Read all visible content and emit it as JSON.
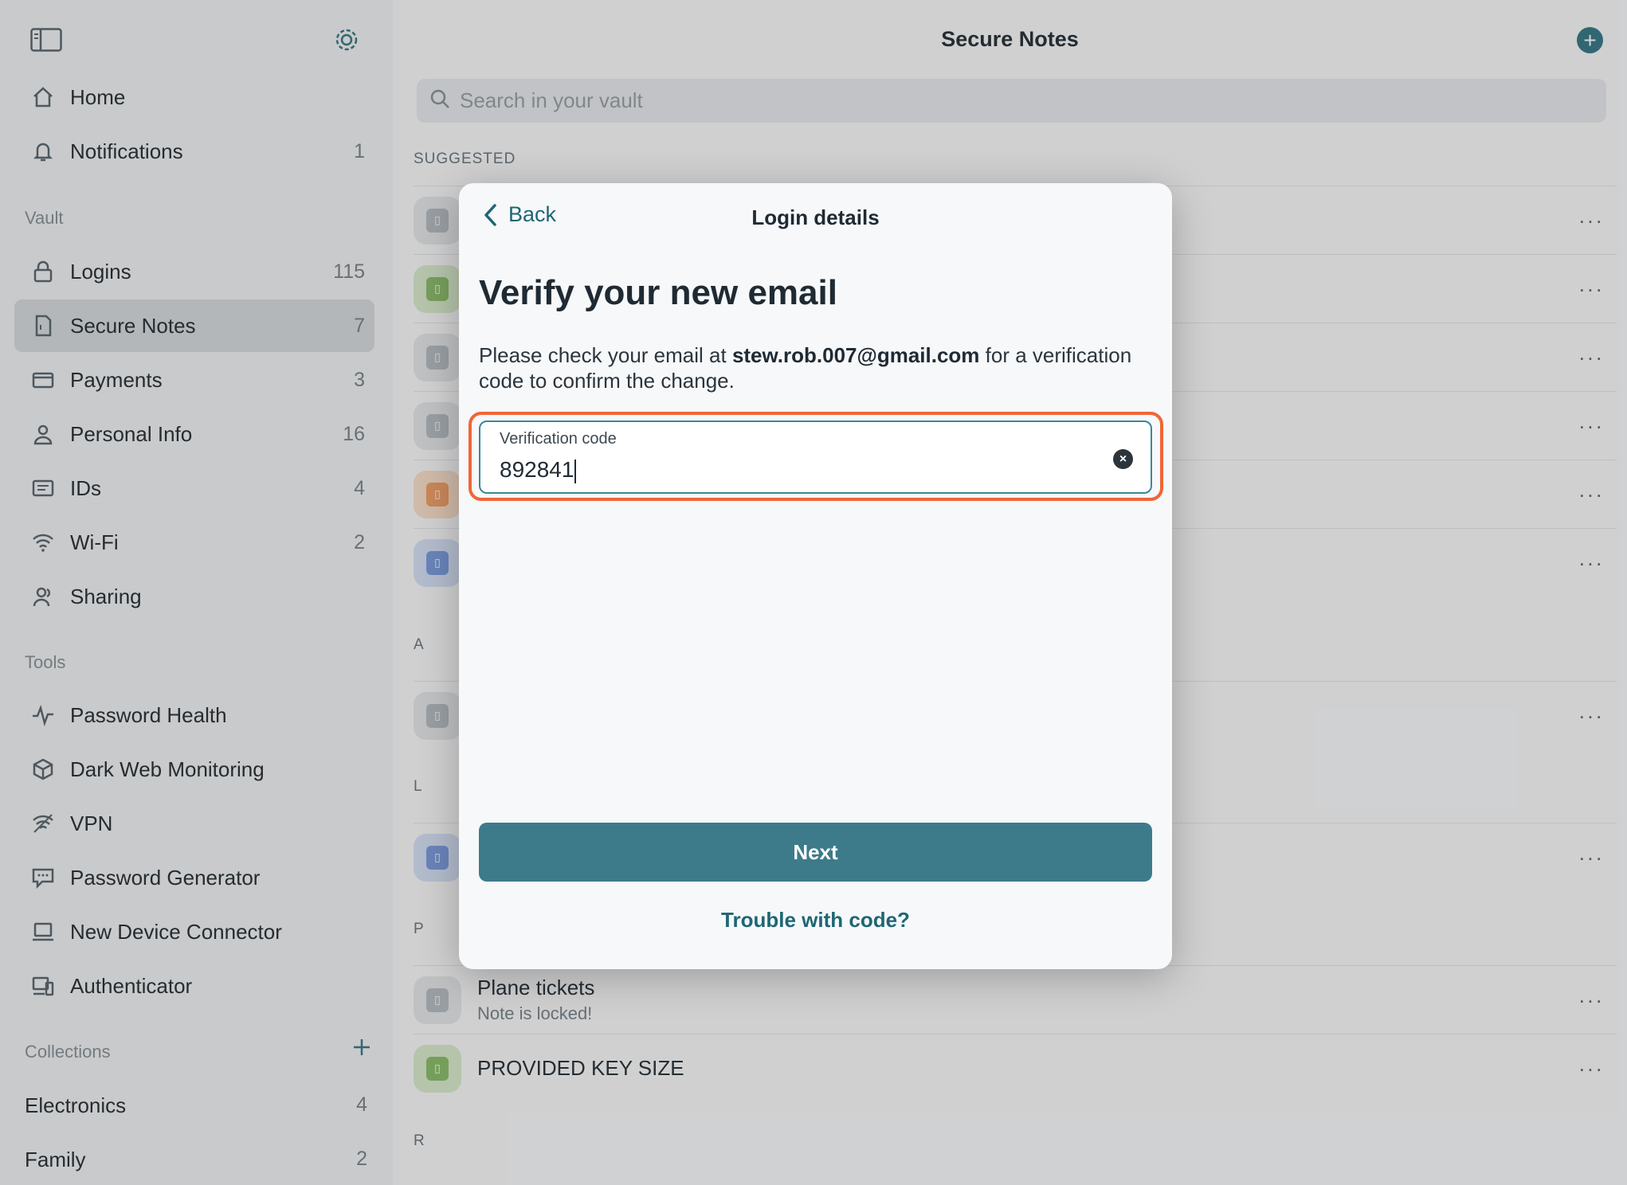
{
  "sidebar": {
    "top_items": [
      {
        "label": "Home",
        "count": "",
        "icon": "home-icon"
      },
      {
        "label": "Notifications",
        "count": "1",
        "icon": "bell-icon"
      }
    ],
    "vault_label": "Vault",
    "vault_items": [
      {
        "label": "Logins",
        "count": "115",
        "icon": "lock-icon"
      },
      {
        "label": "Secure Notes",
        "count": "7",
        "icon": "note-icon"
      },
      {
        "label": "Payments",
        "count": "3",
        "icon": "card-icon"
      },
      {
        "label": "Personal Info",
        "count": "16",
        "icon": "person-icon"
      },
      {
        "label": "IDs",
        "count": "4",
        "icon": "id-icon"
      },
      {
        "label": "Wi-Fi",
        "count": "2",
        "icon": "wifi-icon"
      },
      {
        "label": "Sharing",
        "count": "",
        "icon": "sharing-icon"
      }
    ],
    "tools_label": "Tools",
    "tools_items": [
      {
        "label": "Password Health",
        "icon": "pulse-icon"
      },
      {
        "label": "Dark Web Monitoring",
        "icon": "cube-icon"
      },
      {
        "label": "VPN",
        "icon": "vpn-icon"
      },
      {
        "label": "Password Generator",
        "icon": "generator-icon"
      },
      {
        "label": "New Device Connector",
        "icon": "laptop-icon"
      },
      {
        "label": "Authenticator",
        "icon": "authenticator-icon"
      }
    ],
    "collections_label": "Collections",
    "collections": [
      {
        "label": "Electronics",
        "count": "4"
      },
      {
        "label": "Family",
        "count": "2"
      }
    ]
  },
  "main": {
    "title": "Secure Notes",
    "search_placeholder": "Search in your vault",
    "suggested_label": "SUGGESTED",
    "letters": [
      "A",
      "L",
      "P",
      "R"
    ],
    "plane_title": "Plane tickets",
    "plane_subtitle": "Note is locked!",
    "provided_title": "PROVIDED KEY SIZE",
    "more_glyph": "···"
  },
  "modal": {
    "back_label": "Back",
    "title": "Login details",
    "heading": "Verify your new email",
    "desc_prefix": "Please check your email at ",
    "desc_email": "stew.rob.007@gmail.com",
    "desc_suffix": " for a verification code to confirm the change.",
    "field_label": "Verification code",
    "field_value": "892841",
    "next_label": "Next",
    "trouble_label": "Trouble with code?"
  },
  "colors": {
    "accent": "#3d7b8a",
    "highlight": "#f26536",
    "note_green": "#8fbf6e",
    "note_orange": "#f2a26a",
    "note_blue": "#7f9fe0",
    "note_gray": "#b9bfc4"
  }
}
